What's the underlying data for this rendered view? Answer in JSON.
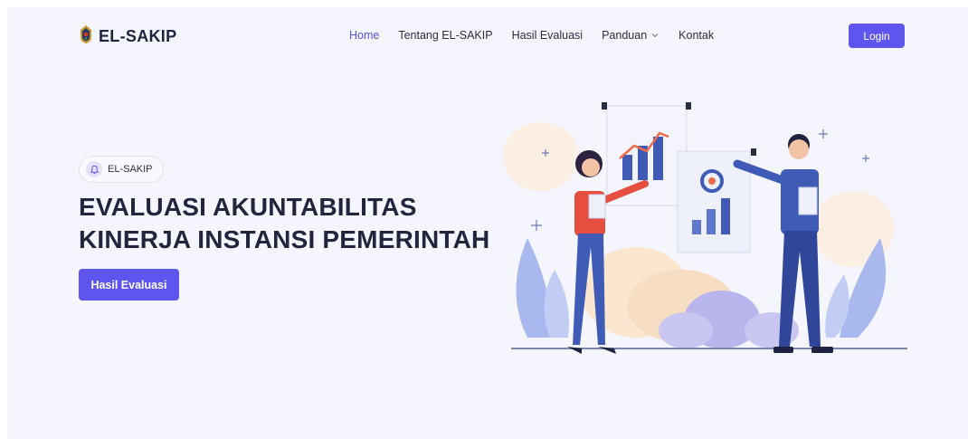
{
  "navbar": {
    "brand": "EL-SAKIP",
    "links": [
      {
        "label": "Home",
        "active": true
      },
      {
        "label": "Tentang EL-SAKIP"
      },
      {
        "label": "Hasil Evaluasi"
      },
      {
        "label": "Panduan",
        "has_dropdown": true
      },
      {
        "label": "Kontak"
      }
    ],
    "login_label": "Login"
  },
  "hero": {
    "badge_text": "EL-SAKIP",
    "title_line1": "EVALUASI AKUNTABILITAS",
    "title_line2": "KINERJA INSTANSI PEMERINTAH",
    "cta_label": "Hasil Evaluasi"
  },
  "colors": {
    "accent": "#5e54ee",
    "background": "#f5f6fd",
    "title": "#23253e"
  },
  "icons": {
    "brand": "emblem-icon",
    "badge": "bell-icon",
    "dropdown": "chevron-down-icon"
  }
}
